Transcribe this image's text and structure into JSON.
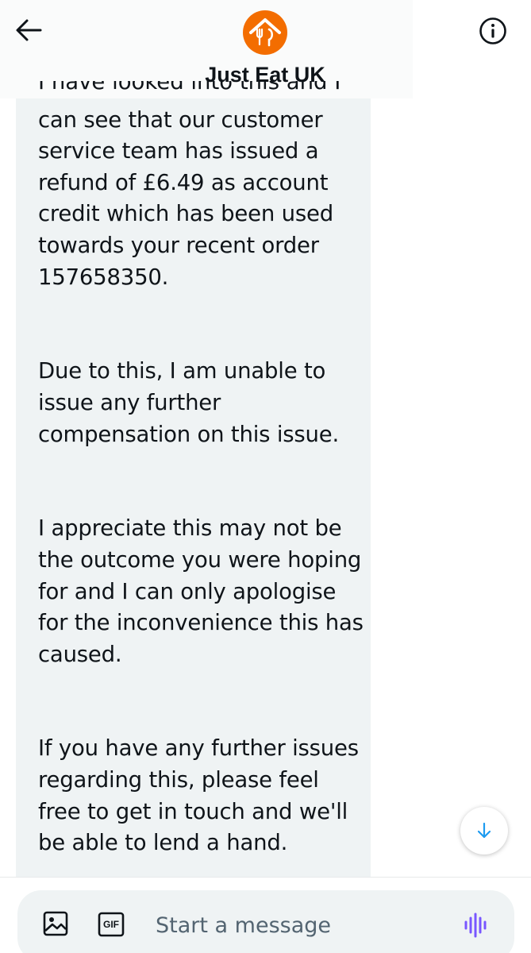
{
  "header": {
    "account_name": "Just Eat UK",
    "logo_color": "#f36d00",
    "back_icon": "arrow-left-icon",
    "info_icon": "info-icon"
  },
  "message": {
    "partial_line": "I have looked into this and I",
    "paragraphs": [
      "can see that our customer service team has issued a refund of £6.49 as account credit which has been used towards your recent order 157658350.",
      "Due to this, I am unable to issue any further compensation on this issue.",
      "I appreciate this may not be the outcome you were hoping for and I can only apologise for the inconvenience this has caused.",
      "If you have any further issues regarding this, please feel free to get in touch and we'll be able to lend a hand."
    ],
    "bubble_color": "#eff3f4"
  },
  "composer": {
    "placeholder": "Start a message",
    "gif_label": "GIF",
    "media_icon": "image-icon",
    "voice_icon": "voice-wave-icon",
    "accent_color": "#7856ff"
  },
  "scroll_down": {
    "icon": "arrow-down-icon",
    "color": "#1d9bf0"
  }
}
